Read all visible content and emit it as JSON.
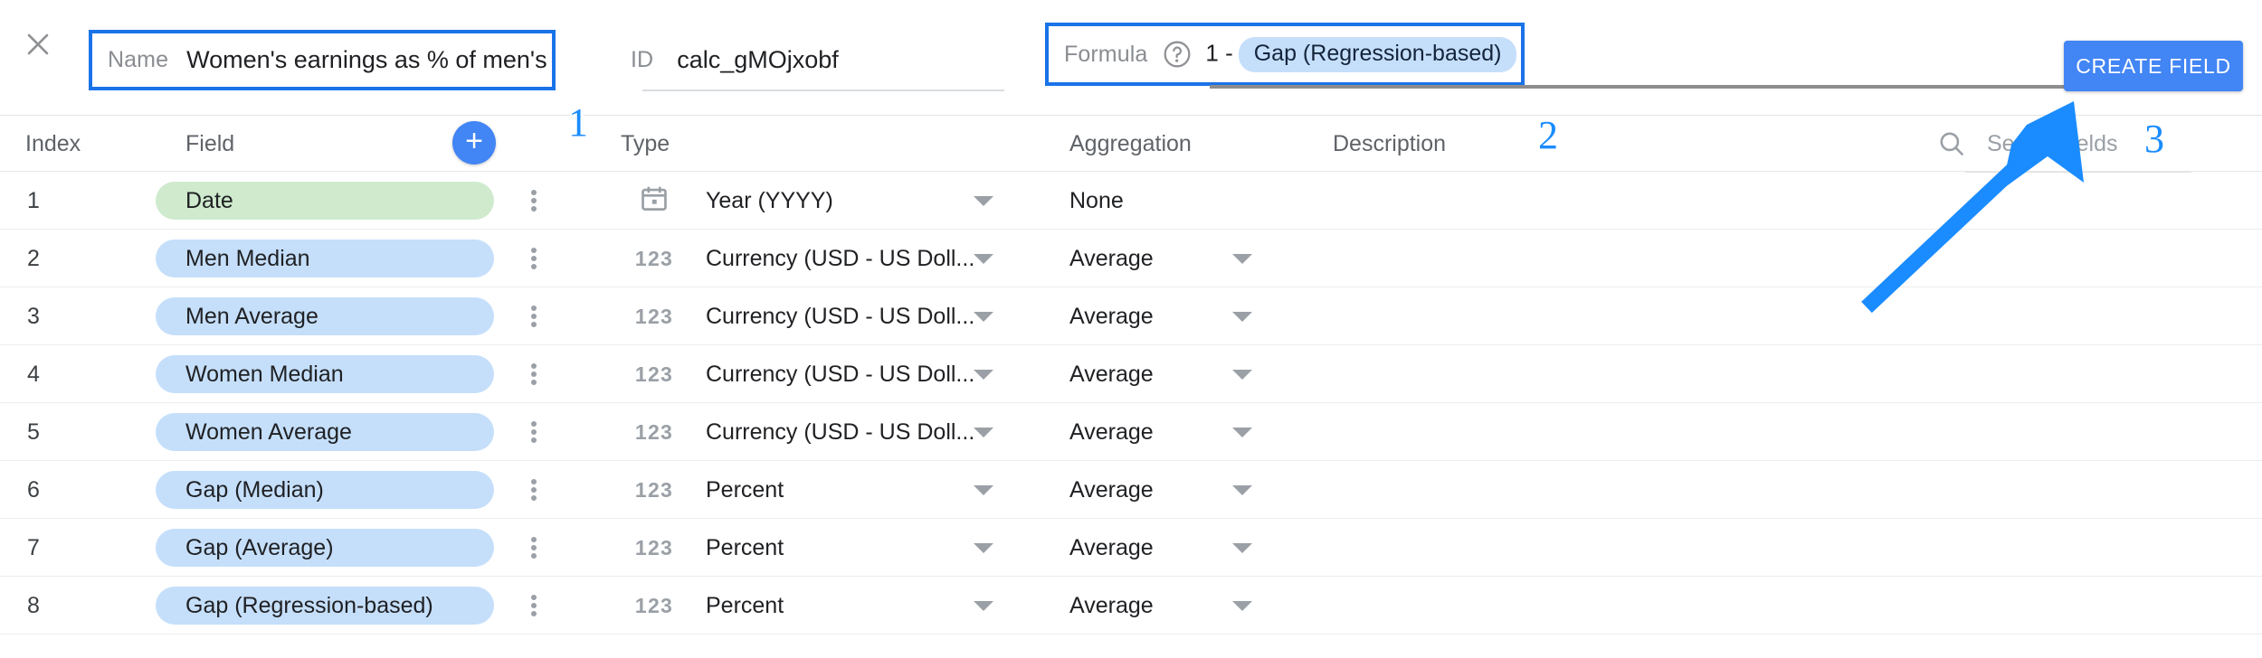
{
  "header": {
    "close_icon": "close-icon",
    "name_label": "Name",
    "name_value": "Women's earnings as % of men's",
    "id_label": "ID",
    "id_value": "calc_gMOjxobf",
    "formula_label": "Formula",
    "help_icon": "help-circle-icon",
    "formula_prefix": "1 -",
    "formula_chip": "Gap (Regression-based)",
    "create_button": "CREATE FIELD"
  },
  "table": {
    "columns": {
      "index": "Index",
      "field": "Field",
      "type": "Type",
      "aggregation": "Aggregation",
      "description": "Description"
    },
    "add_button": "+",
    "search_icon": "search-icon",
    "search_placeholder": "Search fields",
    "rows": [
      {
        "index": "1",
        "field": "Date",
        "chip_kind": "dim",
        "type_icon": "calendar-icon",
        "type": "Year (YYYY)",
        "type_has_caret": true,
        "aggregation": "None",
        "agg_has_caret": false
      },
      {
        "index": "2",
        "field": "Men Median",
        "chip_kind": "met",
        "type_icon": "number-123-icon",
        "type": "Currency (USD - US Doll...",
        "type_has_caret": true,
        "aggregation": "Average",
        "agg_has_caret": true
      },
      {
        "index": "3",
        "field": "Men Average",
        "chip_kind": "met",
        "type_icon": "number-123-icon",
        "type": "Currency (USD - US Doll...",
        "type_has_caret": true,
        "aggregation": "Average",
        "agg_has_caret": true
      },
      {
        "index": "4",
        "field": "Women Median",
        "chip_kind": "met",
        "type_icon": "number-123-icon",
        "type": "Currency (USD - US Doll...",
        "type_has_caret": true,
        "aggregation": "Average",
        "agg_has_caret": true
      },
      {
        "index": "5",
        "field": "Women Average",
        "chip_kind": "met",
        "type_icon": "number-123-icon",
        "type": "Currency (USD - US Doll...",
        "type_has_caret": true,
        "aggregation": "Average",
        "agg_has_caret": true
      },
      {
        "index": "6",
        "field": "Gap (Median)",
        "chip_kind": "met",
        "type_icon": "number-123-icon",
        "type": "Percent",
        "type_has_caret": true,
        "aggregation": "Average",
        "agg_has_caret": true
      },
      {
        "index": "7",
        "field": "Gap (Average)",
        "chip_kind": "met",
        "type_icon": "number-123-icon",
        "type": "Percent",
        "type_has_caret": true,
        "aggregation": "Average",
        "agg_has_caret": true
      },
      {
        "index": "8",
        "field": "Gap (Regression-based)",
        "chip_kind": "met",
        "type_icon": "number-123-icon",
        "type": "Percent",
        "type_has_caret": true,
        "aggregation": "Average",
        "agg_has_caret": true
      }
    ]
  },
  "annotations": {
    "marker_1": "1",
    "marker_2": "2",
    "marker_3": "3",
    "arrow_color": "#1a8cff"
  },
  "colors": {
    "accent_blue": "#1a73e8",
    "button_blue": "#4285f4",
    "dimension_chip": "#cfeacd",
    "metric_chip": "#c5dffb",
    "annotation_blue": "#1a8cff"
  }
}
